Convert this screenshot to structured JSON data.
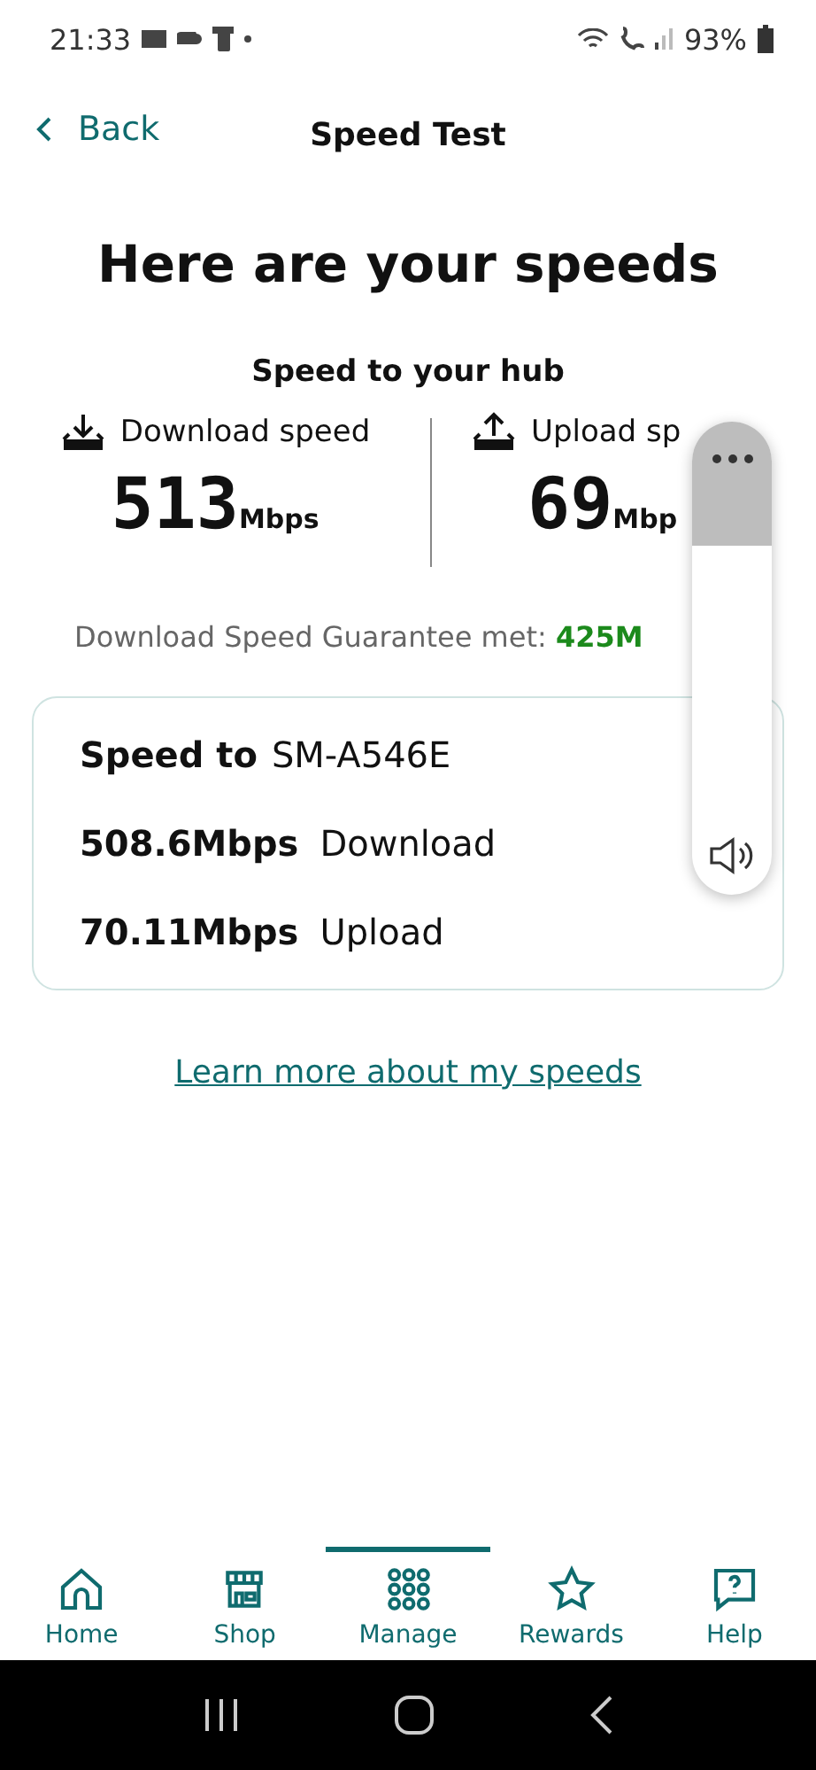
{
  "status_bar": {
    "time": "21:33",
    "battery": "93%"
  },
  "header": {
    "back": "Back",
    "title": "Speed Test"
  },
  "heading": "Here are your speeds",
  "hub": {
    "title": "Speed to your hub",
    "metrics": [
      {
        "kind": "download",
        "label": "Download speed",
        "value": "513",
        "unit": "Mbps"
      },
      {
        "kind": "upload",
        "label": "Upload sp",
        "value": "69",
        "unit": "Mbp"
      }
    ]
  },
  "guarantee": {
    "label": "Download Speed Guarantee met:",
    "value": "425M"
  },
  "device_card": {
    "label": "Speed to",
    "device": "SM-A546E",
    "rows": [
      {
        "value": "508.6Mbps",
        "label": "Download"
      },
      {
        "value": "70.11Mbps",
        "label": "Upload"
      }
    ]
  },
  "link": "Learn more about my speeds",
  "tabs": [
    {
      "kind": "home",
      "label": "Home",
      "selected": false
    },
    {
      "kind": "shop",
      "label": "Shop",
      "selected": false
    },
    {
      "kind": "manage",
      "label": "Manage",
      "selected": true
    },
    {
      "kind": "rewards",
      "label": "Rewards",
      "selected": false
    },
    {
      "kind": "help",
      "label": "Help",
      "selected": false
    }
  ]
}
